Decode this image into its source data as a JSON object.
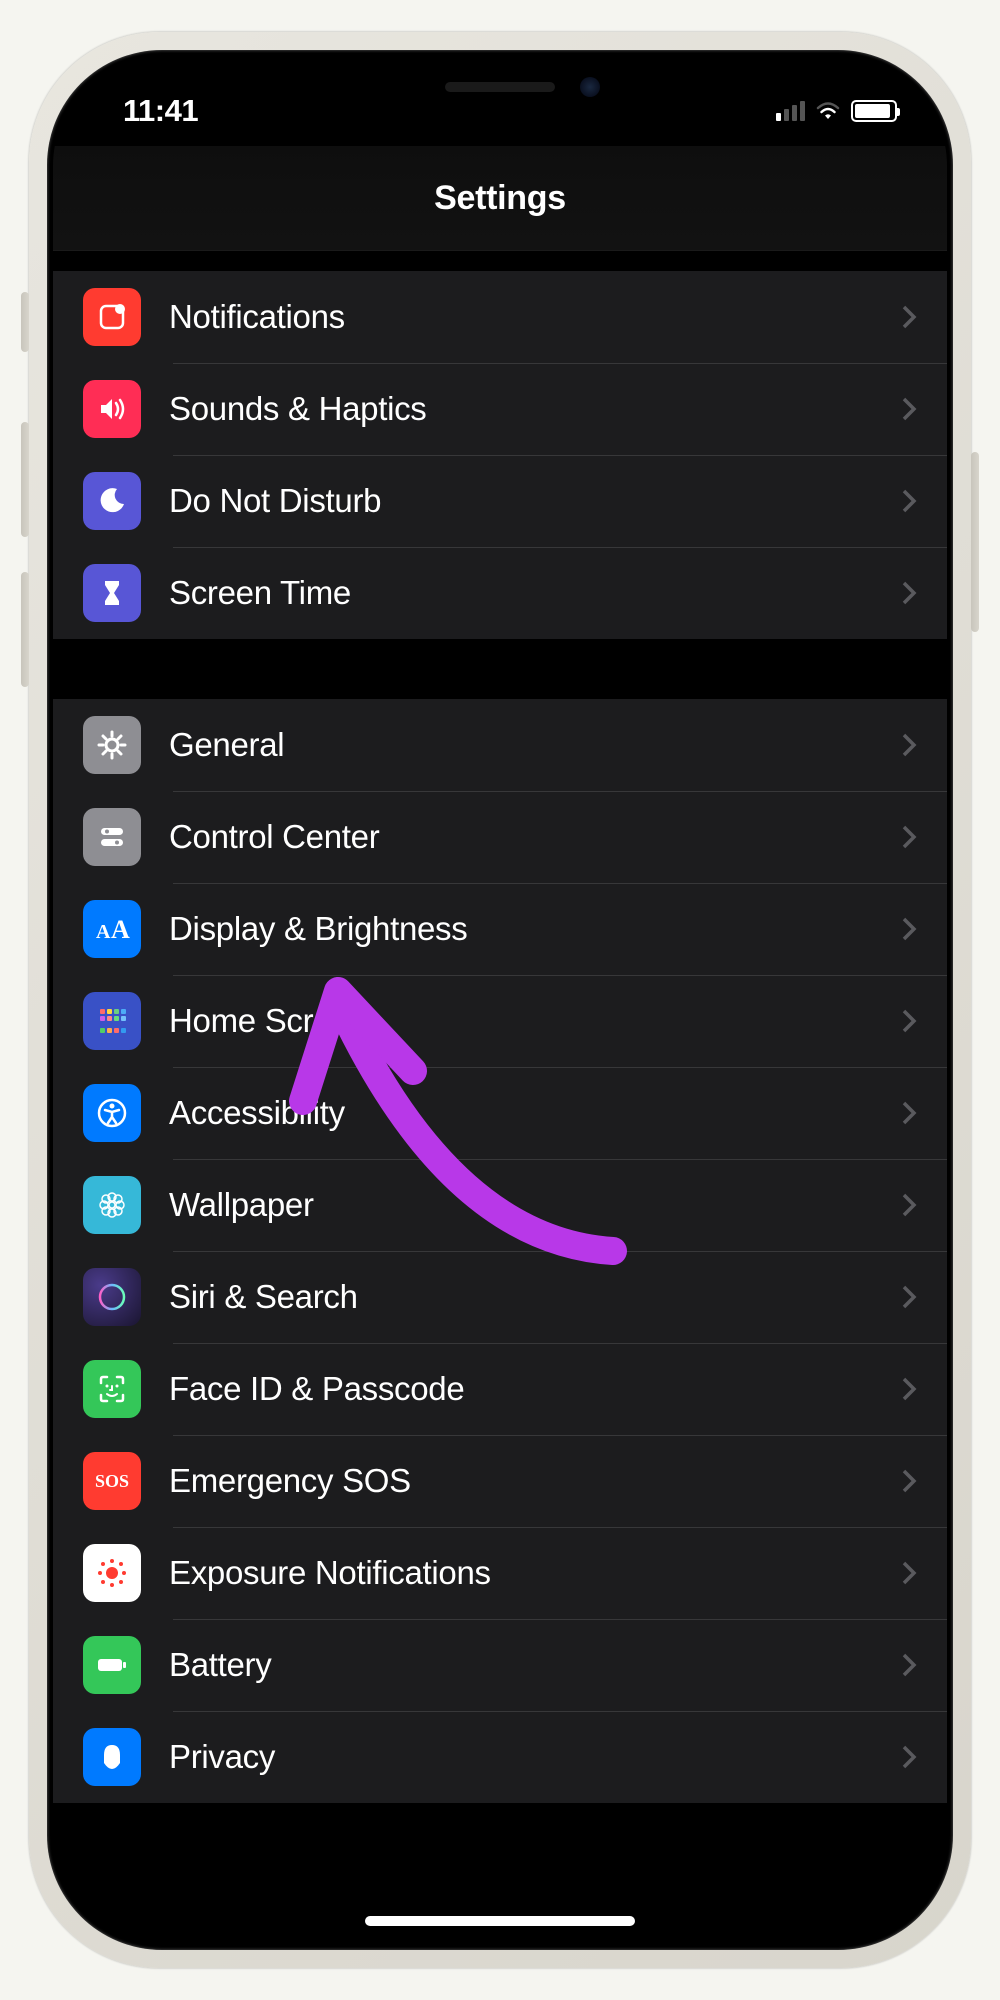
{
  "status": {
    "time": "11:41"
  },
  "header": {
    "title": "Settings"
  },
  "groups": [
    {
      "items": [
        {
          "id": "notifications",
          "label": "Notifications",
          "icon": "notifications-icon",
          "color": "#ff3b30"
        },
        {
          "id": "sounds",
          "label": "Sounds & Haptics",
          "icon": "sounds-icon",
          "color": "#ff2d55"
        },
        {
          "id": "dnd",
          "label": "Do Not Disturb",
          "icon": "dnd-icon",
          "color": "#5856d6"
        },
        {
          "id": "screentime",
          "label": "Screen Time",
          "icon": "screentime-icon",
          "color": "#5856d6"
        }
      ]
    },
    {
      "items": [
        {
          "id": "general",
          "label": "General",
          "icon": "general-icon",
          "color": "#8e8e93"
        },
        {
          "id": "control-center",
          "label": "Control Center",
          "icon": "control-center-icon",
          "color": "#8e8e93"
        },
        {
          "id": "display",
          "label": "Display & Brightness",
          "icon": "display-icon",
          "color": "#007aff"
        },
        {
          "id": "home-screen",
          "label": "Home Screen",
          "icon": "home-screen-icon",
          "color": "#3355cc"
        },
        {
          "id": "accessibility",
          "label": "Accessibility",
          "icon": "accessibility-icon",
          "color": "#007aff"
        },
        {
          "id": "wallpaper",
          "label": "Wallpaper",
          "icon": "wallpaper-icon",
          "color": "#36b8d8"
        },
        {
          "id": "siri",
          "label": "Siri & Search",
          "icon": "siri-icon",
          "color": "#222"
        },
        {
          "id": "faceid",
          "label": "Face ID & Passcode",
          "icon": "faceid-icon",
          "color": "#34c759"
        },
        {
          "id": "sos",
          "label": "Emergency SOS",
          "icon": "sos-icon",
          "color": "#ff3b30"
        },
        {
          "id": "exposure",
          "label": "Exposure Notifications",
          "icon": "exposure-icon",
          "color": "#fff"
        },
        {
          "id": "battery",
          "label": "Battery",
          "icon": "battery-icon",
          "color": "#34c759"
        },
        {
          "id": "privacy",
          "label": "Privacy",
          "icon": "privacy-icon",
          "color": "#007aff"
        }
      ]
    }
  ],
  "annotation": {
    "color": "#b838e8",
    "target": "accessibility"
  }
}
